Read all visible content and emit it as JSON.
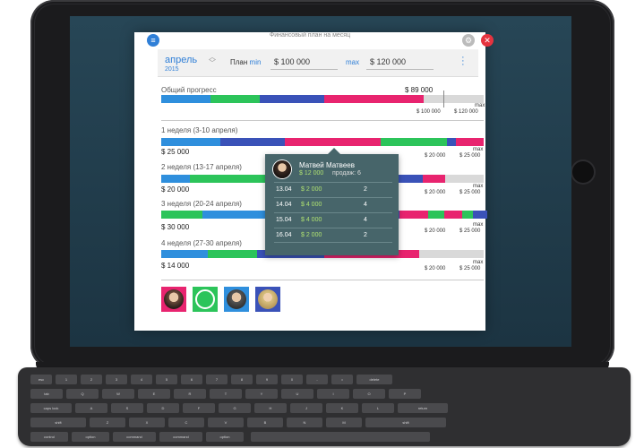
{
  "app": {
    "title": "Финансовый план на месяц",
    "menu_icon": "menu-icon",
    "settings_icon": "gear-icon",
    "close_icon": "close-icon"
  },
  "header": {
    "month": "апрель",
    "year": "2015",
    "plan_label": "План",
    "min_label": "min",
    "min_value": "$ 100 000",
    "max_label": "max",
    "max_value": "$ 120 000"
  },
  "overall": {
    "label": "Общий прогресс",
    "amount": "$ 89 000",
    "min_value": "$ 100 000",
    "max_label": "max",
    "max_value": "$ 120 000"
  },
  "weeks": [
    {
      "label": "1 неделя (3-10 апреля)",
      "amount": "$ 25 000",
      "min_value": "$ 20 000",
      "max_label": "max",
      "max_value": "$ 25 000"
    },
    {
      "label": "2 неделя (13-17 апреля)",
      "amount": "$ 20 000",
      "min_value": "$ 20 000",
      "max_label": "max",
      "max_value": "$ 25 000"
    },
    {
      "label": "3 неделя (20-24 апреля)",
      "amount": "$ 30 000",
      "min_value": "$ 20 000",
      "max_label": "max",
      "max_value": "$ 25 000"
    },
    {
      "label": "4 неделя (27-30 апреля)",
      "amount": "$ 14 000",
      "min_value": "$ 20 000",
      "max_label": "max",
      "max_value": "$ 25 000"
    }
  ],
  "tooltip": {
    "name": "Матвей Матвеев",
    "sum": "$ 12 000",
    "sales_label": "продаж: 6",
    "rows": [
      {
        "date": "13.04",
        "amount": "$ 2 000",
        "count": "2"
      },
      {
        "date": "14.04",
        "amount": "$ 4 000",
        "count": "4"
      },
      {
        "date": "15.04",
        "amount": "$ 4 000",
        "count": "4"
      },
      {
        "date": "16.04",
        "amount": "$ 2 000",
        "count": "2"
      }
    ]
  },
  "colors": {
    "blue": "#2f8fdd",
    "green": "#2cc45a",
    "navy": "#3a52b8",
    "pink": "#e8246f",
    "gray": "#d9d9d9"
  },
  "keyboard_keys": [
    "esc",
    "1",
    "2",
    "3",
    "4",
    "5",
    "6",
    "7",
    "8",
    "9",
    "0",
    "-",
    "=",
    "delete",
    "tab",
    "Q",
    "W",
    "E",
    "R",
    "T",
    "Y",
    "U",
    "I",
    "O",
    "P",
    "caps lock",
    "A",
    "S",
    "D",
    "F",
    "G",
    "H",
    "J",
    "K",
    "L",
    "return",
    "shift",
    "Z",
    "X",
    "C",
    "V",
    "B",
    "N",
    "M",
    "shift",
    "control",
    "option",
    "command",
    "command",
    "option"
  ]
}
